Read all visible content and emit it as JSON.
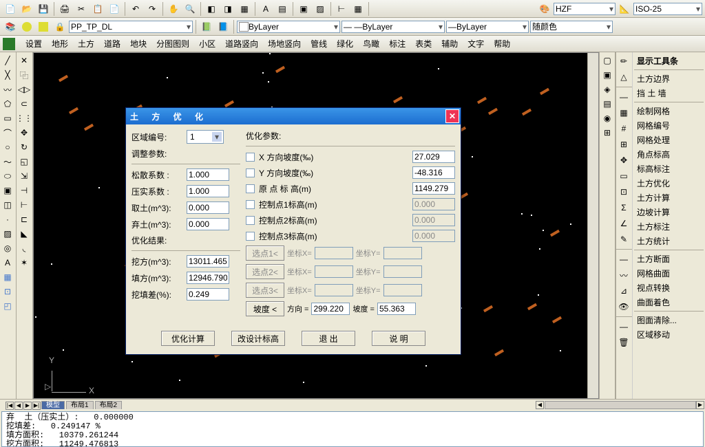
{
  "toolbar": {
    "layer_name": "PP_TP_DL",
    "linetype1": "ByLayer",
    "linetype2": "ByLayer",
    "lineweight": "ByLayer",
    "color": "随颜色",
    "style1": "HZF",
    "style2": "ISO-25"
  },
  "menu": [
    "设置",
    "地形",
    "土方",
    "道路",
    "地块",
    "分图图则",
    "小区",
    "道路竖向",
    "场地竖向",
    "管线",
    "绿化",
    "鸟瞰",
    "标注",
    "表类",
    "辅助",
    "文字",
    "帮助"
  ],
  "right_panel": {
    "title": "显示工具条",
    "groups": [
      [
        "土方边界",
        "挡 土 墙"
      ],
      [
        "绘制网格",
        "网格编号",
        "网格处理",
        "角点标高",
        "标高标注",
        "土方优化",
        "土方计算",
        "边坡计算",
        "土方标注",
        "土方统计"
      ],
      [
        "土方断面",
        "网格曲面",
        "视点转换",
        "曲面着色"
      ],
      [
        "图面清除...",
        "区域移动"
      ]
    ]
  },
  "tabs": {
    "nav": [
      "|◀",
      "◀",
      "▶",
      "▶|"
    ],
    "items": [
      "模型",
      "布局1",
      "布局2"
    ]
  },
  "cmd": [
    "弃  土（压实土）:   0.000000",
    "挖填差:   0.249147 %",
    "填方面积:   10379.261244",
    "挖方面积:   11249.476813"
  ],
  "dialog": {
    "title": "土 方 优 化",
    "region_label": "区域编号:",
    "region_value": "1",
    "adj_title": "调整参数:",
    "adj": [
      {
        "label": "松散系数 :",
        "value": "1.000"
      },
      {
        "label": "压实系数 :",
        "value": "1.000"
      },
      {
        "label": "取土(m^3):",
        "value": "0.000"
      },
      {
        "label": "弃土(m^3):",
        "value": "0.000"
      }
    ],
    "res_title": "优化结果:",
    "res": [
      {
        "label": "挖方(m^3):",
        "value": "13011.465"
      },
      {
        "label": "填方(m^3):",
        "value": "12946.790"
      },
      {
        "label": "挖填差(%):",
        "value": "0.249"
      }
    ],
    "opt_title": "优化参数:",
    "opt": [
      {
        "label": "X 方向坡度(‰)",
        "value": "27.029",
        "disabled": false
      },
      {
        "label": "Y 方向坡度(‰)",
        "value": "-48.316",
        "disabled": false
      },
      {
        "label": "原 点 标 高(m)",
        "value": "1149.279",
        "disabled": false
      },
      {
        "label": "控制点1标高(m)",
        "value": "0.000",
        "disabled": true
      },
      {
        "label": "控制点2标高(m)",
        "value": "0.000",
        "disabled": true
      },
      {
        "label": "控制点3标高(m)",
        "value": "0.000",
        "disabled": true
      }
    ],
    "sel_buttons": [
      "选点1<",
      "选点2<",
      "选点3<"
    ],
    "coord_x": "坐标X=",
    "coord_y": "坐标Y=",
    "slope_btn": "坡度 <",
    "dir_label": "方向 =",
    "dir_value": "299.220",
    "slope_label": "坡度 =",
    "slope_value": "55.363",
    "buttons": [
      "优化计算",
      "改设计标高",
      "退 出",
      "说 明"
    ]
  },
  "canvas": {
    "axis_x": "X",
    "axis_y": "Y"
  }
}
